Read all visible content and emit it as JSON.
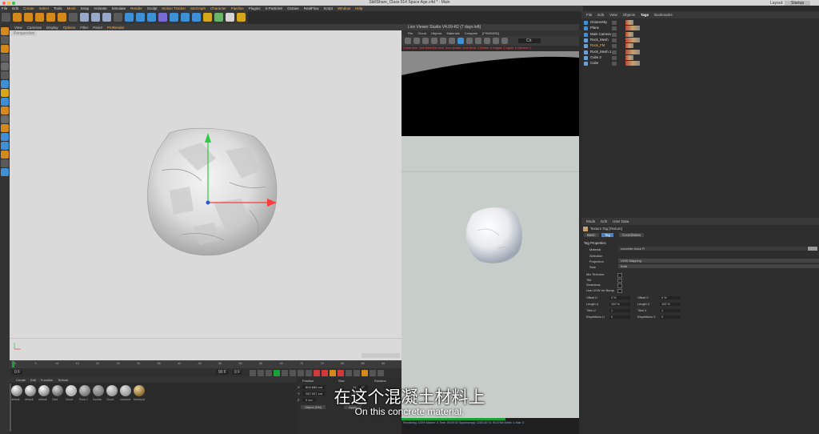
{
  "window": {
    "title": "SkillShare_Class 014 Space Age.c4d * - Main",
    "layout_label": "Layout:",
    "layout_value": "Startup"
  },
  "menu": [
    "File",
    "Edit",
    "Create",
    "Select",
    "Tools",
    "Mesh",
    "Snap",
    "Animate",
    "Simulate",
    "Render",
    "Sculpt",
    "Motion Tracker",
    "MoGraph",
    "Character",
    "Pipeline",
    "Plugins",
    "X-Particles",
    "Octane",
    "RealFlow",
    "Script",
    "Window",
    "Help"
  ],
  "menu_highlight": [
    "Create",
    "Select",
    "Mesh",
    "Render",
    "Motion Tracker",
    "MoGraph",
    "Character",
    "Pipeline",
    "Window",
    "Help"
  ],
  "viewport_menu": [
    "View",
    "Cameras",
    "Display",
    "Options",
    "Filter",
    "Panel",
    "ProRender"
  ],
  "viewport_menu_highlight": [
    "Options",
    "ProRender"
  ],
  "viewport_label": "Perspective",
  "timeline": {
    "ticks": [
      "0",
      "5",
      "10",
      "15",
      "20",
      "25",
      "30",
      "35",
      "40",
      "45",
      "50",
      "55",
      "60",
      "65",
      "70",
      "75",
      "80",
      "85",
      "90"
    ],
    "frame_start": "0 F",
    "frame_end": "90 F",
    "current": "0 F"
  },
  "materials": {
    "menu": [
      "Create",
      "Edit",
      "Function",
      "Texture"
    ],
    "items": [
      "default",
      "default",
      "default",
      "Clnd",
      "Cloud",
      "Rock.1",
      "Ksstick",
      "Cloud",
      "concrete",
      "Metal.pol"
    ]
  },
  "coords": {
    "headers": [
      "Position",
      "Size",
      "Rotation"
    ],
    "rows": [
      [
        "X",
        "804.689 cm",
        "H",
        "0°"
      ],
      [
        "Y",
        "287.007 cm",
        "P",
        "0°"
      ],
      [
        "Z",
        "0 cm",
        "B",
        "0°"
      ]
    ],
    "mode": "Object (Rel)",
    "apply": "Apply"
  },
  "live_viewer": {
    "title": "Live Viewer Studio V4.09-R2 (7 days left)",
    "menu": [
      "File",
      "Cloud",
      "Objects",
      "Materials",
      "Compare",
      "[FINISHED]"
    ],
    "zoom": "Clr.",
    "status_red": "Check time: 0ms   MeshGen time: 0ms  Update: 0ms   Mesh: 1   Nodes: 4   Images: 1   Lights: 0   Camera: 0",
    "status": [
      "Rendering: 100%  Ms/sec: 0   Time: 00:00:02   Spp/maxspp: 128/128   Tri: 93.078m   Mesh: 1   Hair: 0"
    ]
  },
  "objects": {
    "menu": [
      "File",
      "Edit",
      "View",
      "Objects",
      "Tags",
      "Bookmarks"
    ],
    "menu_highlight": [
      "Tags"
    ],
    "rows": [
      "OctaneSky",
      "Plane",
      "Main Camera",
      "Rock_Mesh",
      "Rock_FM",
      "Rock_Mesh.1",
      "Cube.2",
      "Cube"
    ],
    "selected": "Rock_FM"
  },
  "attributes": {
    "menu": [
      "Mode",
      "Edit",
      "User Data"
    ],
    "tag_title": "Texture Tag [Texture]",
    "tabs": [
      "Basic",
      "Tag",
      "Coordinates"
    ],
    "active_tab": "Tag",
    "section": "Tag Properties",
    "material_label": "Material",
    "material_value": "concrete block Fl",
    "rows": [
      "Selection",
      "Projection",
      "Side"
    ],
    "projection_value": "UVW Mapping",
    "side_value": "Both",
    "checks": [
      "Mix Textures",
      "Tile",
      "Seamless",
      "Use UVW for Bump"
    ],
    "offset": [
      [
        "Offset U",
        "0 %",
        "Offset V",
        "0 %"
      ],
      [
        "Length U",
        "100 %",
        "Length V",
        "100 %"
      ],
      [
        "Tiles U",
        "1",
        "Tiles V",
        "1"
      ],
      [
        "Repetitions U",
        "0",
        "Repetitions V",
        "0"
      ]
    ]
  },
  "subtitle_cn": "在这个混凝土材料上",
  "subtitle_en": "On this concrete material."
}
